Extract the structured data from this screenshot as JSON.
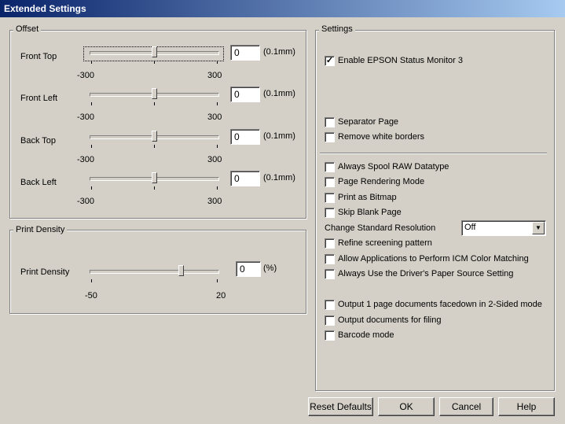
{
  "window": {
    "title": "Extended Settings"
  },
  "offset": {
    "legend": "Offset",
    "unit": "(0.1mm)",
    "rows": [
      {
        "label": "Front Top",
        "value": "0",
        "min": "-300",
        "max": "300",
        "position": 0.5
      },
      {
        "label": "Front Left",
        "value": "0",
        "min": "-300",
        "max": "300",
        "position": 0.5
      },
      {
        "label": "Back Top",
        "value": "0",
        "min": "-300",
        "max": "300",
        "position": 0.5
      },
      {
        "label": "Back Left",
        "value": "0",
        "min": "-300",
        "max": "300",
        "position": 0.5
      }
    ]
  },
  "density": {
    "legend": "Print Density",
    "label": "Print Density",
    "value": "0",
    "unit": "(%)",
    "min": "-50",
    "max": "20",
    "position": 0.714
  },
  "settings": {
    "legend": "Settings",
    "status_monitor": {
      "label": "Enable EPSON Status Monitor 3",
      "checked": true
    },
    "group1": [
      {
        "label": "Separator Page",
        "checked": false
      },
      {
        "label": "Remove white borders",
        "checked": false
      }
    ],
    "group2": [
      {
        "label": "Always Spool RAW Datatype",
        "checked": false
      },
      {
        "label": "Page Rendering Mode",
        "checked": false
      },
      {
        "label": "Print as Bitmap",
        "checked": false
      },
      {
        "label": "Skip Blank Page",
        "checked": false
      }
    ],
    "resolution": {
      "label": "Change Standard Resolution",
      "value": "Off"
    },
    "group3": [
      {
        "label": "Refine screening pattern",
        "checked": false
      },
      {
        "label": "Allow Applications to Perform ICM Color Matching",
        "checked": false
      },
      {
        "label": "Always Use the Driver's Paper Source Setting",
        "checked": false
      }
    ],
    "group4": [
      {
        "label": "Output 1 page documents facedown in 2-Sided mode",
        "checked": false
      },
      {
        "label": "Output documents for filing",
        "checked": false
      },
      {
        "label": "Barcode mode",
        "checked": false
      }
    ]
  },
  "buttons": {
    "reset": "Reset Defaults",
    "ok": "OK",
    "cancel": "Cancel",
    "help": "Help"
  },
  "icons": {
    "dropdown": "chevron-down-icon",
    "check": "checkmark-icon"
  }
}
